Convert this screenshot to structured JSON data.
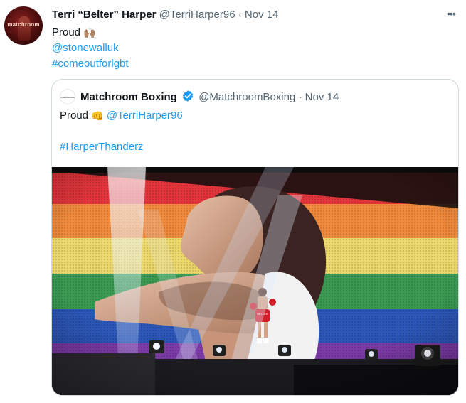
{
  "tweet": {
    "avatar_label": "matchroom",
    "display_name": "Terri “Belter” Harper",
    "handle": "@TerriHarper96",
    "separator": "·",
    "date": "Nov 14",
    "more_glyph": "•••",
    "text": "Proud",
    "clap_glyph": "🙌🏽",
    "mention": "@stonewalluk",
    "hashtag": "#comeoutforlgbt"
  },
  "quoted": {
    "avatar_label": "matchroom",
    "display_name": "Matchroom Boxing",
    "handle": "@MatchroomBoxing",
    "separator": "·",
    "date": "Nov 14",
    "text": "Proud",
    "fist_glyph": "👊",
    "mention": "@TerriHarper96",
    "hashtag": "#HarperThanderz",
    "verified_color": "#1d9bf0",
    "trunks_label": "BELTER"
  },
  "colors": {
    "link": "#1d9bf0",
    "secondary_text": "#536471",
    "border": "#cfd9de"
  }
}
